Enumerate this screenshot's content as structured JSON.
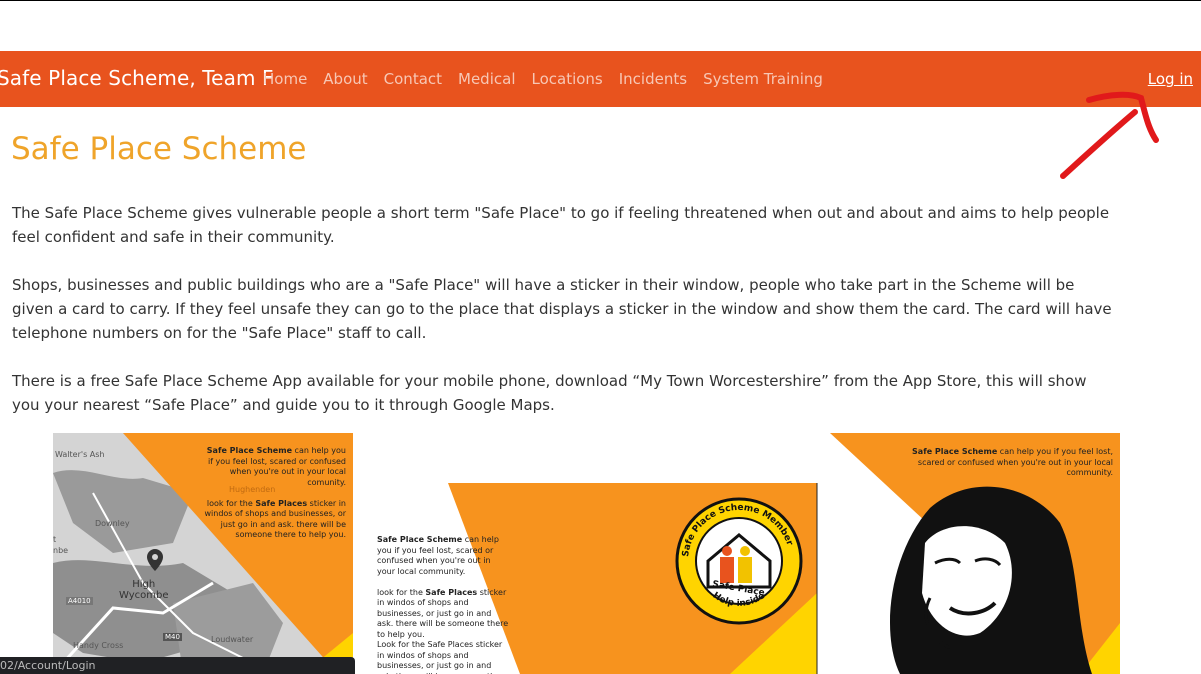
{
  "navbar": {
    "brand": "Safe Place Scheme, Team F",
    "links": [
      "Home",
      "About",
      "Contact",
      "Medical",
      "Locations",
      "Incidents",
      "System Training"
    ],
    "login": "Log in"
  },
  "main": {
    "title": "Safe Place Scheme",
    "paragraphs": [
      "The Safe Place Scheme gives vulnerable people a short term \"Safe Place\" to go if feeling threatened when out and about and aims to help people feel confident and safe in their community.",
      "Shops, businesses and public buildings who are a \"Safe Place\" will have a sticker in their window, people who take part in the Scheme will be given a card to carry. If they feel unsafe they can go to the place that displays a sticker in the window and show them the card. The card will have telephone numbers on for the \"Safe Place\" staff to call.",
      "There is a free Safe Place Scheme App available for your mobile phone, download “My Town Worcestershire” from the App Store, this will show you your nearest “Safe Place” and guide you to it through Google Maps."
    ]
  },
  "images": {
    "map_card": {
      "bold": "Safe Place Scheme",
      "text1": " can help you if you feel lost, scared or confused when you're out in your local comunity.",
      "text2a": "look for the ",
      "bold2": "Safe Places",
      "text2b": " sticker in windos of shops and businesses, or just go in and ask. there will be someone there to help you.",
      "places": {
        "walters_ash": "Walter's Ash",
        "downley": "Downley",
        "high_wycombe": "High\nWycombe",
        "handy_cross": "Handy Cross",
        "loudwater": "Loudwater",
        "a4010": "A4010",
        "m40": "M40",
        "hughenden": "Hughenden",
        "nbe": "nbe",
        "tt": "t"
      }
    },
    "sticker_card": {
      "bold": "Safe Place Scheme",
      "text1": " can help you if you feel lost, scared or confused when you're out in your local community.",
      "text2a": "look for the ",
      "bold2": "Safe Places",
      "text2b": " sticker in windos of shops and businesses, or just go in and ask. there will be someone there to help you.",
      "text3": "Look for the Safe Places sticker in windos of shops and businesses, or just go in and ask. there will be someone there to help you.",
      "badge_top": "Safe Place Scheme Member",
      "badge_mid": "Safe Place",
      "badge_bottom": "Help inside"
    },
    "face_card": {
      "bold": "Safe Place Scheme",
      "text1": " can help you if you feel lost, scared or confused when you're out in your local community."
    }
  },
  "status_bar": {
    "url": "02/Account/Login"
  },
  "colors": {
    "navbar": "#e8531e",
    "title": "#efa42a",
    "orange": "#f7931e",
    "yellow": "#ffd400",
    "annotation": "#e1191b"
  }
}
